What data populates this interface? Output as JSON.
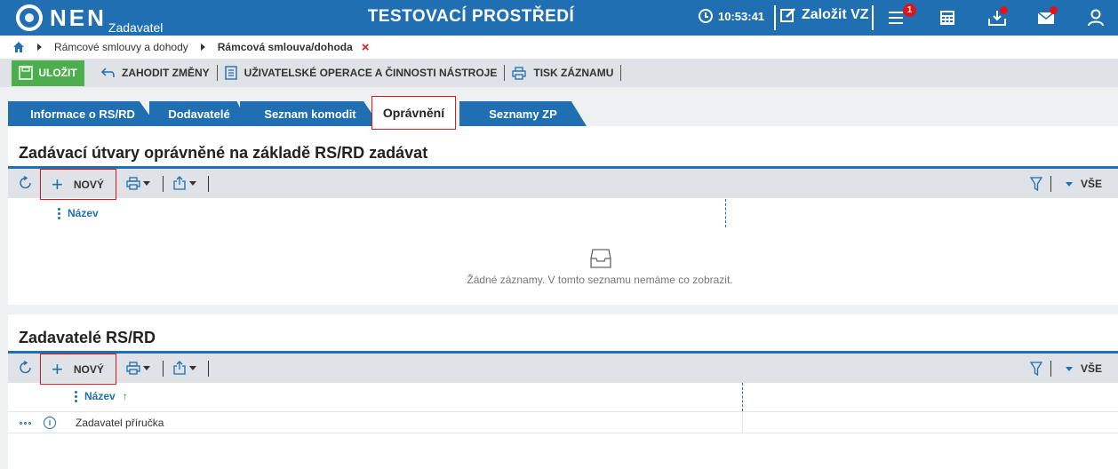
{
  "topbar": {
    "logo": "NEN",
    "role": "Zadavatel",
    "environment": "TESTOVACÍ PROSTŘEDÍ",
    "time": "10:53:41",
    "create_vz": "Založit VZ",
    "menu_badge": "1",
    "icons": [
      "hamburger-menu-icon",
      "calculator-icon",
      "inbox-download-icon",
      "mail-icon",
      "user-icon"
    ]
  },
  "breadcrumb": {
    "items": [
      "Rámcové smlouvy a dohody",
      "Rámcová smlouva/dohoda"
    ],
    "close": "×"
  },
  "actions": {
    "save": "ULOŽIT",
    "discard": "ZAHODIT ZMĚNY",
    "user_ops": "UŽIVATELSKÉ OPERACE A ČINNOSTI NÁSTROJE",
    "print": "TISK ZÁZNAMU"
  },
  "tabs": [
    {
      "label": "Informace o RS/RD"
    },
    {
      "label": "Dodavatelé"
    },
    {
      "label": "Seznam komodit"
    },
    {
      "label": "Oprávnění",
      "active": true
    },
    {
      "label": "Seznamy ZP"
    }
  ],
  "section1": {
    "title": "Zadávací útvary oprávněné na základě RS/RD zadávat",
    "new_label": "NOVÝ",
    "all_label": "VŠE",
    "column": "Název",
    "empty_text": "Žádné záznamy. V tomto seznamu nemáme co zobrazit."
  },
  "section2": {
    "title": "Zadavatelé RS/RD",
    "new_label": "NOVÝ",
    "all_label": "VŠE",
    "column": "Název",
    "sort_indicator": "↑",
    "rows": [
      {
        "name": "Zadavatel příručka"
      }
    ]
  },
  "colors": {
    "brand": "#1f6fb2",
    "save_green": "#4cae4c",
    "alert_red": "#e0151b",
    "toolbar_gray": "#dfe2e6"
  }
}
